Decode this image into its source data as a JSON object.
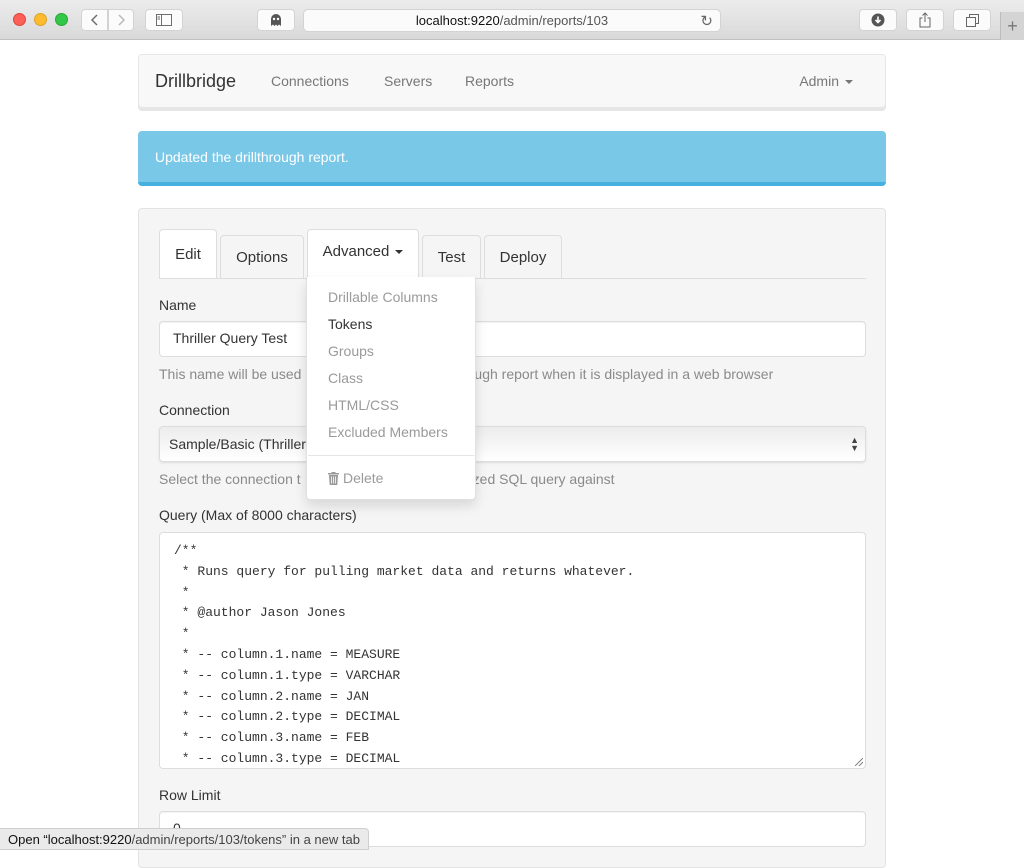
{
  "browser": {
    "url_host": "localhost:9220",
    "url_path": "/admin/reports/103",
    "icons": {
      "back": "chevron-left-icon",
      "forward": "chevron-right-icon",
      "sidebar": "sidebar-icon",
      "ghostery": "ghost-icon",
      "reload": "reload-icon",
      "download": "download-icon",
      "share": "share-icon",
      "tabs": "tabs-icon",
      "new_tab": "plus-icon"
    },
    "status_text": "Open “localhost:9220/admin/reports/103/tokens” in a new tab",
    "status_host": "Open “localhost:9220",
    "status_rest": "/admin/reports/103/tokens” in a new tab"
  },
  "navbar": {
    "brand": "Drillbridge",
    "links": [
      "Connections",
      "Servers",
      "Reports"
    ],
    "user_menu": "Admin"
  },
  "alert": {
    "message": "Updated the drillthrough report.",
    "color": "#79c8e8"
  },
  "tabs": [
    {
      "label": "Edit",
      "active": true
    },
    {
      "label": "Options",
      "active": false
    },
    {
      "label": "Advanced",
      "active": false,
      "dropdown_open": true
    },
    {
      "label": "Test",
      "active": false
    },
    {
      "label": "Deploy",
      "active": false
    }
  ],
  "advanced_menu": {
    "items": [
      {
        "label": "Drillable Columns"
      },
      {
        "label": "Tokens",
        "hovered": true
      },
      {
        "label": "Groups"
      },
      {
        "label": "Class"
      },
      {
        "label": "HTML/CSS"
      },
      {
        "label": "Excluded Members"
      }
    ],
    "delete_label": "Delete"
  },
  "form": {
    "name": {
      "label": "Name",
      "value": "Thriller Query Test",
      "help": "This name will be used to identify the drillthrough report when it is displayed in a web browser",
      "help_left": "This name will be used",
      "help_right": "ugh report when it is displayed in a web browser"
    },
    "connection": {
      "label": "Connection",
      "selected": "Sample/Basic (Thriller",
      "help": "Select the connection to run the parameterized SQL query against",
      "help_left": "Select the connection t",
      "help_right": "zed SQL query against"
    },
    "query": {
      "label": "Query (Max of 8000 characters)",
      "lines": [
        "/**",
        " * Runs query for pulling market data and returns whatever.",
        " *",
        " * @author Jason Jones",
        " *",
        " * -- column.1.name = MEASURE",
        " * -- column.1.type = VARCHAR",
        " * -- column.2.name = JAN",
        " * -- column.2.type = DECIMAL",
        " * -- column.3.name = FEB",
        " * -- column.3.type = DECIMAL"
      ]
    },
    "row_limit": {
      "label": "Row Limit",
      "value": "0"
    }
  }
}
